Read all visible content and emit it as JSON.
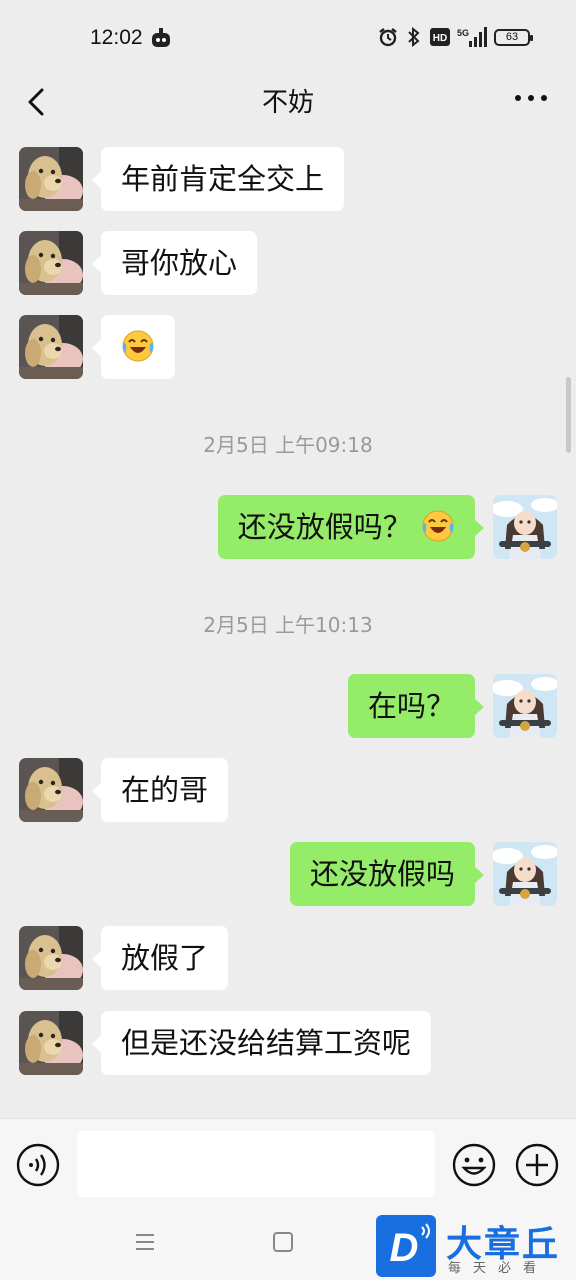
{
  "status_bar": {
    "time": "12:02",
    "network": "5G",
    "hd_label": "HD",
    "battery": "63",
    "icons": [
      "robot-icon",
      "alarm-icon",
      "bluetooth-icon",
      "hd-icon",
      "signal-icon",
      "battery-icon"
    ]
  },
  "header": {
    "title": "不妨",
    "back_icon": "chevron-left-icon",
    "more_icon": "more-icon"
  },
  "messages": [
    {
      "side": "in",
      "text": "年前肯定全交上"
    },
    {
      "side": "in",
      "text": "哥你放心"
    },
    {
      "side": "in",
      "text": "",
      "emoji": "laughing-crying-emoji"
    },
    {
      "type": "timestamp",
      "text": "2月5日 上午09:18"
    },
    {
      "side": "out",
      "text": "还没放假吗？",
      "emoji": "laughing-crying-emoji"
    },
    {
      "type": "timestamp",
      "text": "2月5日 上午10:13"
    },
    {
      "side": "out",
      "text": "在吗？"
    },
    {
      "side": "in",
      "text": "在的哥"
    },
    {
      "side": "out",
      "text": "还没放假吗"
    },
    {
      "side": "in",
      "text": "放假了"
    },
    {
      "side": "in",
      "text": "但是还没给结算工资呢"
    }
  ],
  "input_bar": {
    "value": "",
    "voice_icon": "voice-icon",
    "emoji_icon": "smiley-icon",
    "plus_icon": "plus-icon"
  },
  "watermark": {
    "badge_letter": "D",
    "name": "大章丘",
    "slogan": "每天必看",
    "color": "#1a6fe0"
  },
  "colors": {
    "outgoing_bubble": "#95ec69",
    "incoming_bubble": "#ffffff",
    "background": "#ededed"
  }
}
